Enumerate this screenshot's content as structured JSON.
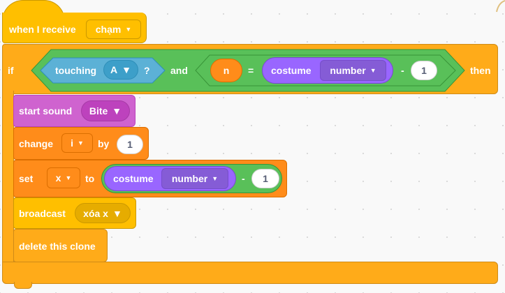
{
  "event_block": {
    "label": "when I receive",
    "message": "chạm"
  },
  "if_block": {
    "if_label": "if",
    "then_label": "then",
    "touching": {
      "label": "touching",
      "target": "A",
      "qmark": "?"
    },
    "and_label": "and",
    "equals": {
      "left_var": "n",
      "op": "=",
      "costume": {
        "label": "costume",
        "attr": "number"
      },
      "minus": "-",
      "value": "1"
    }
  },
  "start_sound": {
    "label": "start sound",
    "sound": "Bite"
  },
  "change_block": {
    "label": "change",
    "var": "i",
    "by": "by",
    "value": "1"
  },
  "set_block": {
    "label": "set",
    "var": "x",
    "to": "to",
    "costume": {
      "label": "costume",
      "attr": "number"
    },
    "minus": "-",
    "value": "1"
  },
  "broadcast": {
    "label": "broadcast",
    "message": "xóa x"
  },
  "delete_clone": {
    "label": "delete this clone"
  },
  "colors": {
    "events": "#ffbf00",
    "control": "#ffab19",
    "sound": "#cf63cf",
    "variables": "#ff8c1a",
    "sensing": "#5cb1d6",
    "looks": "#9966ff",
    "operators": "#59c059"
  }
}
